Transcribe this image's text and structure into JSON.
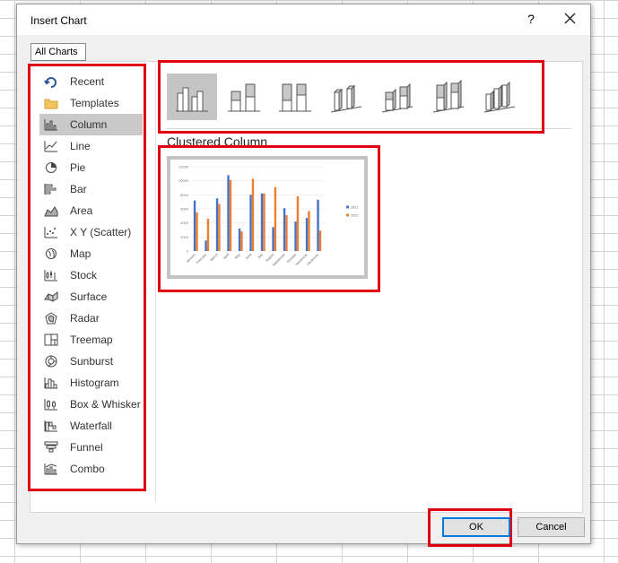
{
  "dialog": {
    "title": "Insert Chart",
    "help_label": "?",
    "tab_label": "All Charts",
    "ok_label": "OK",
    "cancel_label": "Cancel"
  },
  "sidebar": {
    "items": [
      {
        "label": "Recent",
        "icon": "recent-icon"
      },
      {
        "label": "Templates",
        "icon": "templates-folder-icon"
      },
      {
        "label": "Column",
        "icon": "column-chart-icon",
        "selected": true
      },
      {
        "label": "Line",
        "icon": "line-chart-icon"
      },
      {
        "label": "Pie",
        "icon": "pie-chart-icon"
      },
      {
        "label": "Bar",
        "icon": "bar-chart-icon"
      },
      {
        "label": "Area",
        "icon": "area-chart-icon"
      },
      {
        "label": "X Y (Scatter)",
        "icon": "scatter-chart-icon"
      },
      {
        "label": "Map",
        "icon": "map-chart-icon"
      },
      {
        "label": "Stock",
        "icon": "stock-chart-icon"
      },
      {
        "label": "Surface",
        "icon": "surface-chart-icon"
      },
      {
        "label": "Radar",
        "icon": "radar-chart-icon"
      },
      {
        "label": "Treemap",
        "icon": "treemap-chart-icon"
      },
      {
        "label": "Sunburst",
        "icon": "sunburst-chart-icon"
      },
      {
        "label": "Histogram",
        "icon": "histogram-chart-icon"
      },
      {
        "label": "Box & Whisker",
        "icon": "box-whisker-chart-icon"
      },
      {
        "label": "Waterfall",
        "icon": "waterfall-chart-icon"
      },
      {
        "label": "Funnel",
        "icon": "funnel-chart-icon"
      },
      {
        "label": "Combo",
        "icon": "combo-chart-icon"
      }
    ]
  },
  "subtypes": {
    "selected_title": "Clustered Column",
    "icons": [
      "clustered-column-icon",
      "stacked-column-icon",
      "100-stacked-column-icon",
      "3d-clustered-column-icon",
      "3d-stacked-column-icon",
      "3d-100-stacked-column-icon",
      "3d-column-icon"
    ]
  },
  "colors": {
    "highlight": "#e0000f",
    "series_2021": "#4472c4",
    "series_2022": "#ed7d31",
    "selected_bg": "#c9c9c9"
  },
  "chart_data": {
    "type": "bar",
    "title": "",
    "categories": [
      "January",
      "February",
      "March",
      "April",
      "May",
      "June",
      "July",
      "August",
      "September",
      "October",
      "November",
      "December"
    ],
    "series": [
      {
        "name": "2021",
        "values": [
          7200,
          1500,
          7500,
          10800,
          3200,
          8000,
          8200,
          3400,
          6100,
          4200,
          4700,
          7300
        ]
      },
      {
        "name": "2022",
        "values": [
          5500,
          4600,
          6700,
          10100,
          2800,
          10300,
          8200,
          9100,
          5100,
          7800,
          5700,
          2900
        ]
      }
    ],
    "yticks": [
      "0",
      "2000",
      "4000",
      "6000",
      "8000",
      "10000",
      "12000"
    ],
    "ylim": [
      0,
      12000
    ],
    "legend": "right",
    "grid": true
  }
}
